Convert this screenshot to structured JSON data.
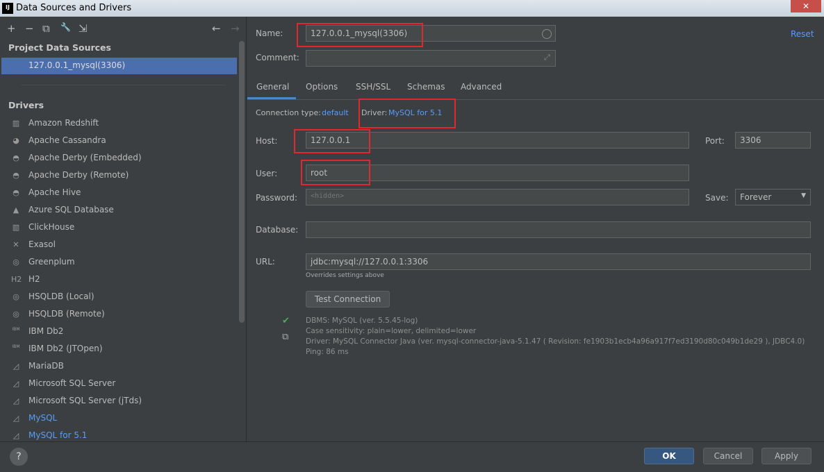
{
  "window": {
    "title": "Data Sources and Drivers",
    "logo": "IJ",
    "close": "✕"
  },
  "toolbar": {
    "add": "+",
    "remove": "−",
    "copy": "⧉",
    "wrench": "🔧",
    "import": "⇲",
    "back": "←",
    "forward": "→"
  },
  "left": {
    "project_header": "Project Data Sources",
    "project_items": [
      "127.0.0.1_mysql(3306)"
    ],
    "drivers_header": "Drivers",
    "drivers": [
      "Amazon Redshift",
      "Apache Cassandra",
      "Apache Derby (Embedded)",
      "Apache Derby (Remote)",
      "Apache Hive",
      "Azure SQL Database",
      "ClickHouse",
      "Exasol",
      "Greenplum",
      "H2",
      "HSQLDB (Local)",
      "HSQLDB (Remote)",
      "IBM Db2",
      "IBM Db2 (JTOpen)",
      "MariaDB",
      "Microsoft SQL Server",
      "Microsoft SQL Server (jTds)",
      "MySQL",
      "MySQL for 5.1"
    ],
    "driver_icons": [
      "▥",
      "◕",
      "◓",
      "◓",
      "◓",
      "▲",
      "▥",
      "✕",
      "◎",
      "H2",
      "◎",
      "◎",
      "IBM",
      "IBM",
      "◿",
      "◿",
      "◿",
      "◿",
      "◿"
    ]
  },
  "form": {
    "name_label": "Name:",
    "name_value": "127.0.0.1_mysql(3306)",
    "comment_label": "Comment:",
    "comment_value": "",
    "reset": "Reset",
    "tabs": [
      "General",
      "Options",
      "SSH/SSL",
      "Schemas",
      "Advanced"
    ],
    "conn_type_label": "Connection type:",
    "conn_type_value": "default",
    "driver_label": "Driver:",
    "driver_value": "MySQL for 5.1",
    "host_label": "Host:",
    "host_value": "127.0.0.1",
    "port_label": "Port:",
    "port_value": "3306",
    "user_label": "User:",
    "user_value": "root",
    "password_label": "Password:",
    "password_placeholder": "<hidden>",
    "save_label": "Save:",
    "save_value": "Forever",
    "database_label": "Database:",
    "database_value": "",
    "url_label": "URL:",
    "url_value": "jdbc:mysql://127.0.0.1:3306",
    "url_hint": "Overrides settings above",
    "test_button": "Test Connection",
    "result": [
      "DBMS: MySQL (ver. 5.5.45-log)",
      "Case sensitivity: plain=lower, delimited=lower",
      "Driver: MySQL Connector Java (ver. mysql-connector-java-5.1.47 ( Revision: fe1903b1ecb4a96a917f7ed3190d80c049b1de29 ), JDBC4.0)",
      "Ping: 86 ms"
    ]
  },
  "footer": {
    "help": "?",
    "ok": "OK",
    "cancel": "Cancel",
    "apply": "Apply"
  },
  "colors": {
    "accent": "#589df6",
    "selection": "#4b6eaf",
    "highlight": "#e0282e"
  }
}
